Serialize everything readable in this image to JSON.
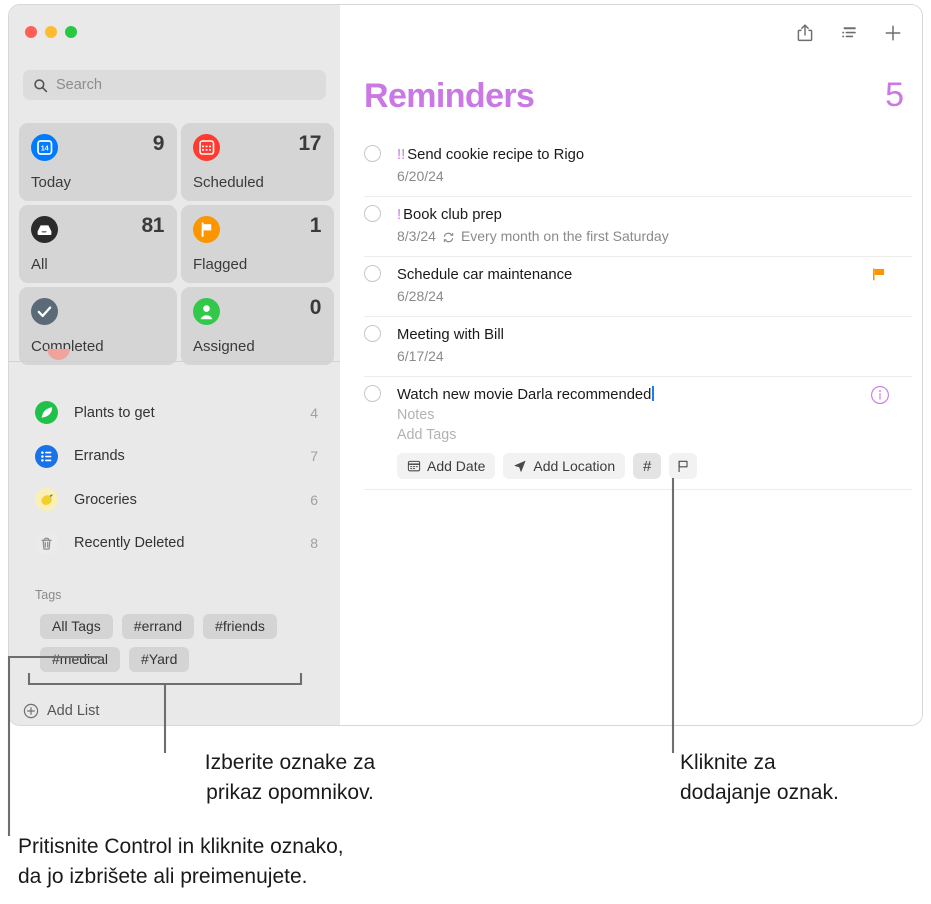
{
  "window": {
    "traffic_lights": [
      "close",
      "minimize",
      "zoom"
    ],
    "colors": {
      "accent_purple": "#c978e4",
      "flag_orange": "#ff9500",
      "sidebar_bg": "#e9e9e9",
      "card_bg": "#d5d5d5",
      "caret_blue": "#1a7aff"
    }
  },
  "sidebar": {
    "search": {
      "placeholder": "Search",
      "value": "",
      "icon": "search-icon"
    },
    "smart_cards": [
      {
        "label": "Today",
        "count": "9",
        "icon": "calendar-icon",
        "icon_color": "#007aff"
      },
      {
        "label": "Scheduled",
        "count": "17",
        "icon": "calendar-days-icon",
        "icon_color": "#ff3b30"
      },
      {
        "label": "All",
        "count": "81",
        "icon": "inbox-icon",
        "icon_color": "#2b2b2b"
      },
      {
        "label": "Flagged",
        "count": "1",
        "icon": "flag-icon",
        "icon_color": "#ff9500"
      },
      {
        "label": "Completed",
        "count": "",
        "icon": "checkmark-icon",
        "icon_color": "#5b6a78"
      },
      {
        "label": "Assigned",
        "count": "0",
        "icon": "person-icon",
        "icon_color": "#32c94a"
      }
    ],
    "lists": [
      {
        "name": "Plants to get",
        "count": "4",
        "icon": "leaf-icon",
        "icon_color": "#1fc14b"
      },
      {
        "name": "Errands",
        "count": "7",
        "icon": "list-icon",
        "icon_color": "#1a72e8"
      },
      {
        "name": "Groceries",
        "count": "6",
        "icon": "lemon-icon",
        "icon_color": "#fbeeb6"
      },
      {
        "name": "Recently Deleted",
        "count": "8",
        "icon": "trash-icon",
        "icon_color": "#ebebeb"
      }
    ],
    "tags_header": "Tags",
    "tags": [
      "All Tags",
      "#errand",
      "#friends",
      "#medical",
      "#Yard"
    ],
    "add_list": {
      "label": "Add List",
      "icon": "plus-circle-icon"
    }
  },
  "main": {
    "toolbar": [
      {
        "name": "share-icon",
        "label": "Share"
      },
      {
        "name": "view-options-icon",
        "label": "View Options"
      },
      {
        "name": "add-reminder-icon",
        "label": "Add Reminder"
      }
    ],
    "title": "Reminders",
    "count": "5",
    "reminders": [
      {
        "priority": "!!",
        "title": "Send cookie recipe to Rigo",
        "date": "6/20/24",
        "repeat": "",
        "flagged": false,
        "info": false
      },
      {
        "priority": "!",
        "title": "Book club prep",
        "date": "8/3/24",
        "repeat": "Every month on the first Saturday",
        "flagged": false,
        "info": false
      },
      {
        "priority": "",
        "title": "Schedule car maintenance",
        "date": "6/28/24",
        "repeat": "",
        "flagged": true,
        "info": false
      },
      {
        "priority": "",
        "title": "Meeting with Bill",
        "date": "6/17/24",
        "repeat": "",
        "flagged": false,
        "info": false
      }
    ],
    "editing_reminder": {
      "title": "Watch new movie Darla recommended",
      "notes_placeholder": "Notes",
      "tags_placeholder": "Add Tags",
      "info": true,
      "buttons": [
        {
          "name": "add-date-button",
          "label": "Add Date",
          "icon": "calendar-small-icon",
          "active": false
        },
        {
          "name": "add-location-button",
          "label": "Add Location",
          "icon": "location-arrow-icon",
          "active": false
        },
        {
          "name": "add-tag-button",
          "label": "#",
          "icon": "hash-icon",
          "active": true
        },
        {
          "name": "flag-button",
          "label": "",
          "icon": "flag-outline-icon",
          "active": false
        }
      ]
    }
  },
  "annotations": [
    {
      "name": "annotation-select-tags",
      "lines": [
        "Izberite oznake za",
        "prikaz opomnikov."
      ]
    },
    {
      "name": "annotation-add-tags",
      "lines": [
        "Kliknite za",
        "dodajanje oznak."
      ]
    },
    {
      "name": "annotation-control-click",
      "lines": [
        "Pritisnite Control in kliknite oznako,",
        "da jo izbrišete ali preimenujete."
      ]
    }
  ]
}
